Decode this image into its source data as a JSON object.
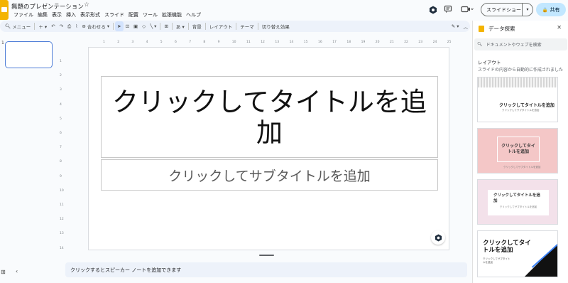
{
  "header": {
    "doc_title": "無題のプレゼンテーション",
    "menu": [
      "ファイル",
      "編集",
      "表示",
      "挿入",
      "表示形式",
      "スライド",
      "配置",
      "ツール",
      "拡張機能",
      "ヘルプ"
    ],
    "slideshow_label": "スライドショー",
    "share_label": "共有"
  },
  "toolbar": {
    "menu_label": "メニュー",
    "zoom_label": "合わせる",
    "background_label": "背景",
    "layout_label": "レイアウト",
    "theme_label": "テーマ",
    "transition_label": "切り替え効果"
  },
  "filmstrip": {
    "slide_number": "1"
  },
  "ruler": {
    "h_ticks": [
      "1",
      "2",
      "3",
      "4",
      "5",
      "6",
      "7",
      "8",
      "9",
      "10",
      "11",
      "12",
      "13",
      "14",
      "15",
      "16",
      "17",
      "18",
      "19",
      "20",
      "21",
      "22",
      "23",
      "24",
      "25"
    ],
    "v_ticks": [
      "1",
      "2",
      "3",
      "4",
      "5",
      "6",
      "7",
      "8",
      "9",
      "10",
      "11",
      "12",
      "13",
      "14"
    ]
  },
  "slide": {
    "title_placeholder": "クリックしてタイトルを追加",
    "subtitle_placeholder": "クリックしてサブタイトルを追加"
  },
  "notes": {
    "placeholder": "クリックするとスピーカー ノートを追加できます"
  },
  "panel": {
    "title": "データ探索",
    "search_placeholder": "ドキュメントやウェブを検索",
    "section_title": "レイアウト",
    "section_desc": "スライドの内容から自動的に作成されました",
    "layouts": [
      {
        "title": "クリックしてタイトルを追加",
        "subtitle": "クリックしてサブタイトルを追加"
      },
      {
        "title": "クリックしてタイトルを追加",
        "subtitle": "クリックしてサブタイトルを追加"
      },
      {
        "title": "クリックしてタイトルを追加",
        "subtitle": "クリックしてサブタイトルを追加"
      },
      {
        "title": "クリックしてタイトルを追加",
        "subtitle": "クリックしてサブタイトルを追加"
      }
    ]
  },
  "colors": {
    "accent": "#1a73e8",
    "share_bg": "#c2e7ff",
    "toolbar_bg": "#edf2fa",
    "brand_yellow": "#f4b400"
  }
}
